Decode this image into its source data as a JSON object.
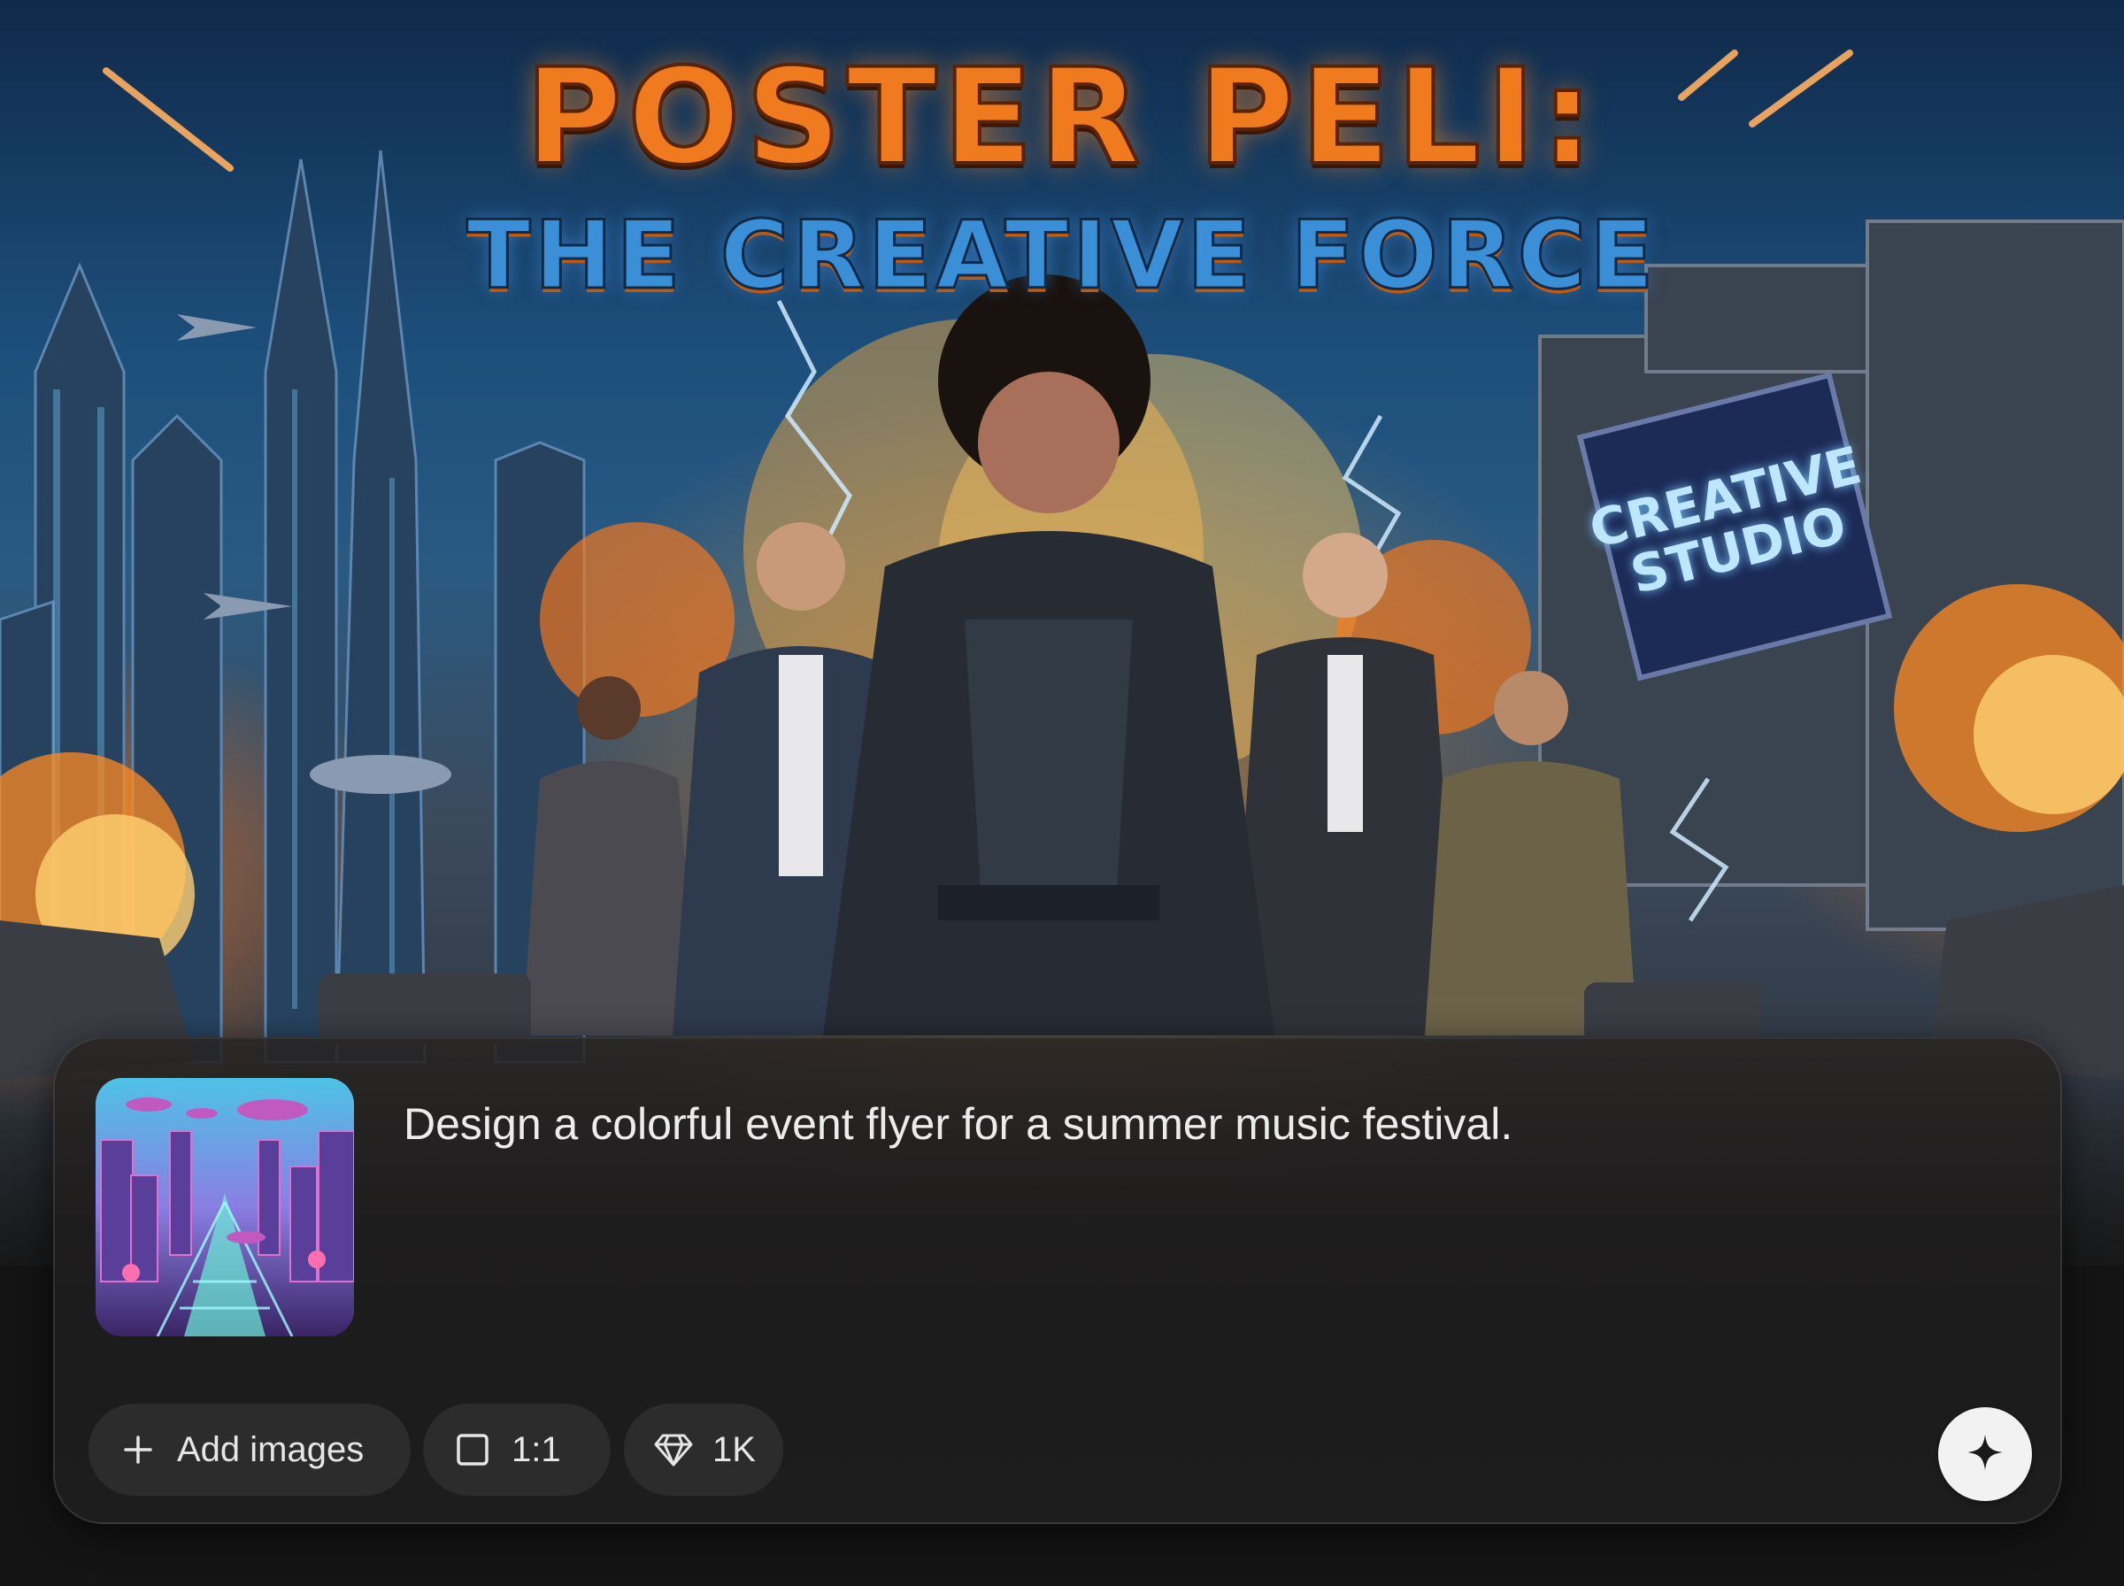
{
  "poster": {
    "title": "POSTER PELI:",
    "subtitle": "THE CREATIVE FORCE",
    "screen_sign_line1": "CREATIVE",
    "screen_sign_line2": "STUDIO"
  },
  "prompt": {
    "text": "Design a colorful event flyer for a summer music festival."
  },
  "toolbar": {
    "add_images_label": "Add images",
    "aspect_ratio_label": "1:1",
    "resolution_label": "1K"
  },
  "icons": {
    "add": "plus-icon",
    "aspect_ratio": "square-icon",
    "resolution": "diamond-icon",
    "generate": "sparkle-icon"
  },
  "colors": {
    "panel_bg": "#1d1d1d",
    "chip_bg": "#2c2c2c",
    "generate_button": "#f2f2f2",
    "title_orange": "#f07a1e",
    "subtitle_blue": "#3b8fd6"
  }
}
